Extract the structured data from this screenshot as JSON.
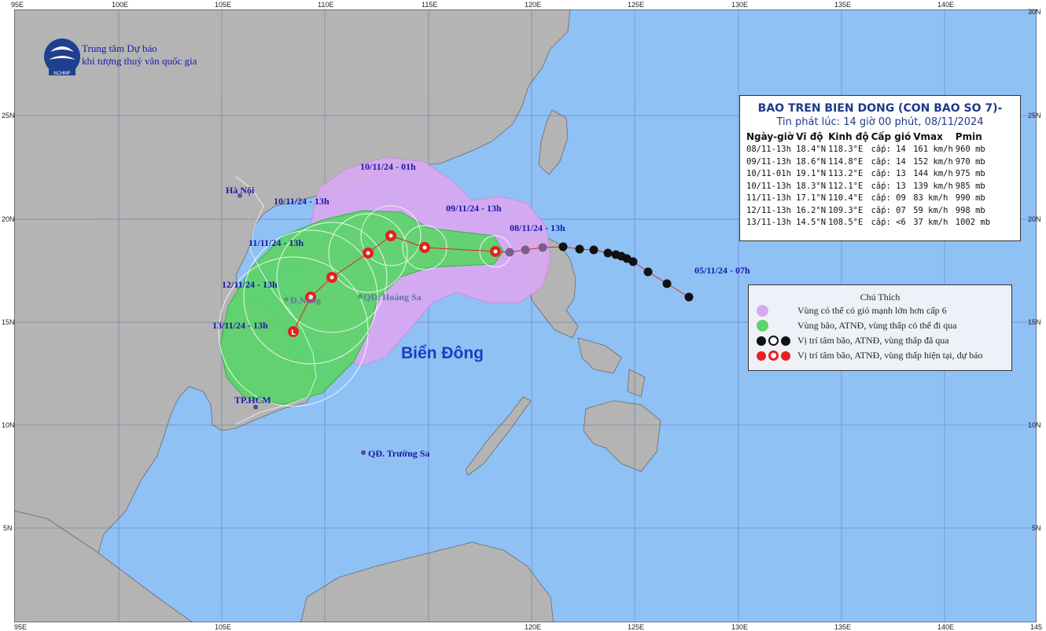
{
  "agency": {
    "name_line1": "Trung tâm Dự báo",
    "name_line2": "khí tượng thuỷ văn quốc gia",
    "logo_text": "NCHMF"
  },
  "info_box": {
    "title": "BAO TREN BIEN DONG (CON BAO SO 7)-",
    "subtitle": "Tin phát lúc: 14 giờ 00 phút, 08/11/2024",
    "headers": [
      "Ngày-giờ",
      "Vĩ độ",
      "Kinh độ",
      "Cấp gió",
      "Vmax",
      "Pmin"
    ],
    "rows": [
      [
        "08/11-13h",
        "18.4°N",
        "118.3°E",
        "cấp: 14",
        "161 km/h",
        "960 mb"
      ],
      [
        "09/11-13h",
        "18.6°N",
        "114.8°E",
        "cấp: 14",
        "152 km/h",
        "970 mb"
      ],
      [
        "10/11-01h",
        "19.1°N",
        "113.2°E",
        "cấp: 13",
        "144 km/h",
        "975 mb"
      ],
      [
        "10/11-13h",
        "18.3°N",
        "112.1°E",
        "cấp: 13",
        "139 km/h",
        "985 mb"
      ],
      [
        "11/11-13h",
        "17.1°N",
        "110.4°E",
        "cấp: 09",
        "83 km/h",
        "990 mb"
      ],
      [
        "12/11-13h",
        "16.2°N",
        "109.3°E",
        "cấp: 07",
        "59 km/h",
        "998 mb"
      ],
      [
        "13/11-13h",
        "14.5°N",
        "108.5°E",
        "cấp: <6",
        "37 km/h",
        "1002 mb"
      ]
    ]
  },
  "legend": {
    "title": "Chú Thích",
    "items": [
      {
        "label": "Vùng có thể có gió mạnh lớn hơn cấp 6",
        "color": "#d9a8f0"
      },
      {
        "label": "Vùng bão, ATNĐ, vùng thấp có thể đi qua",
        "color": "#5ed36b"
      },
      {
        "label": "Vị trí tâm bão, ATNĐ, vùng thấp đã qua",
        "color": "#111111"
      },
      {
        "label": "Vị trí tâm bão, ATNĐ, vùng thấp hiện tại, dự báo",
        "color": "#e8201e"
      }
    ]
  },
  "map_labels": {
    "sea_name": "Biển Đông",
    "hanoi": "Hà Nội",
    "danang": "Đ.Nẵng",
    "hoangsa": "QĐ. Hoàng Sa",
    "truongsa": "QĐ. Trường Sa",
    "hcm": "TP.HCM"
  },
  "track_labels": {
    "t0511": "05/11/24 - 07h",
    "t0811": "08/11/24 - 13h",
    "t0911": "09/11/24 - 13h",
    "t1011a": "10/11/24 - 01h",
    "t1011b": "10/11/24 - 13h",
    "t1111": "11/11/24 - 13h",
    "t1211": "12/11/24 - 13h",
    "t1311": "13/11/24 - 13h"
  },
  "axes": {
    "lon_top": [
      "95E",
      "100E",
      "105E",
      "110E",
      "115E",
      "120E",
      "125E",
      "130E",
      "135E",
      "140E"
    ],
    "lon_bottom": [
      "95E",
      "105E",
      "120E",
      "125E",
      "130E",
      "135E",
      "140E",
      "145"
    ],
    "lat_left": [
      "25N",
      "20N",
      "15N",
      "10N",
      "5N"
    ],
    "lat_right": [
      "25N",
      "20N",
      "15N",
      "10N",
      "5N"
    ],
    "corner_top_right": "30N"
  },
  "colors": {
    "ocean": "#8fc1f5",
    "land": "#b4b4b4",
    "wind_zone": "#d9a8f0",
    "storm_zone": "#5ed36b",
    "track": "#e8201e"
  }
}
